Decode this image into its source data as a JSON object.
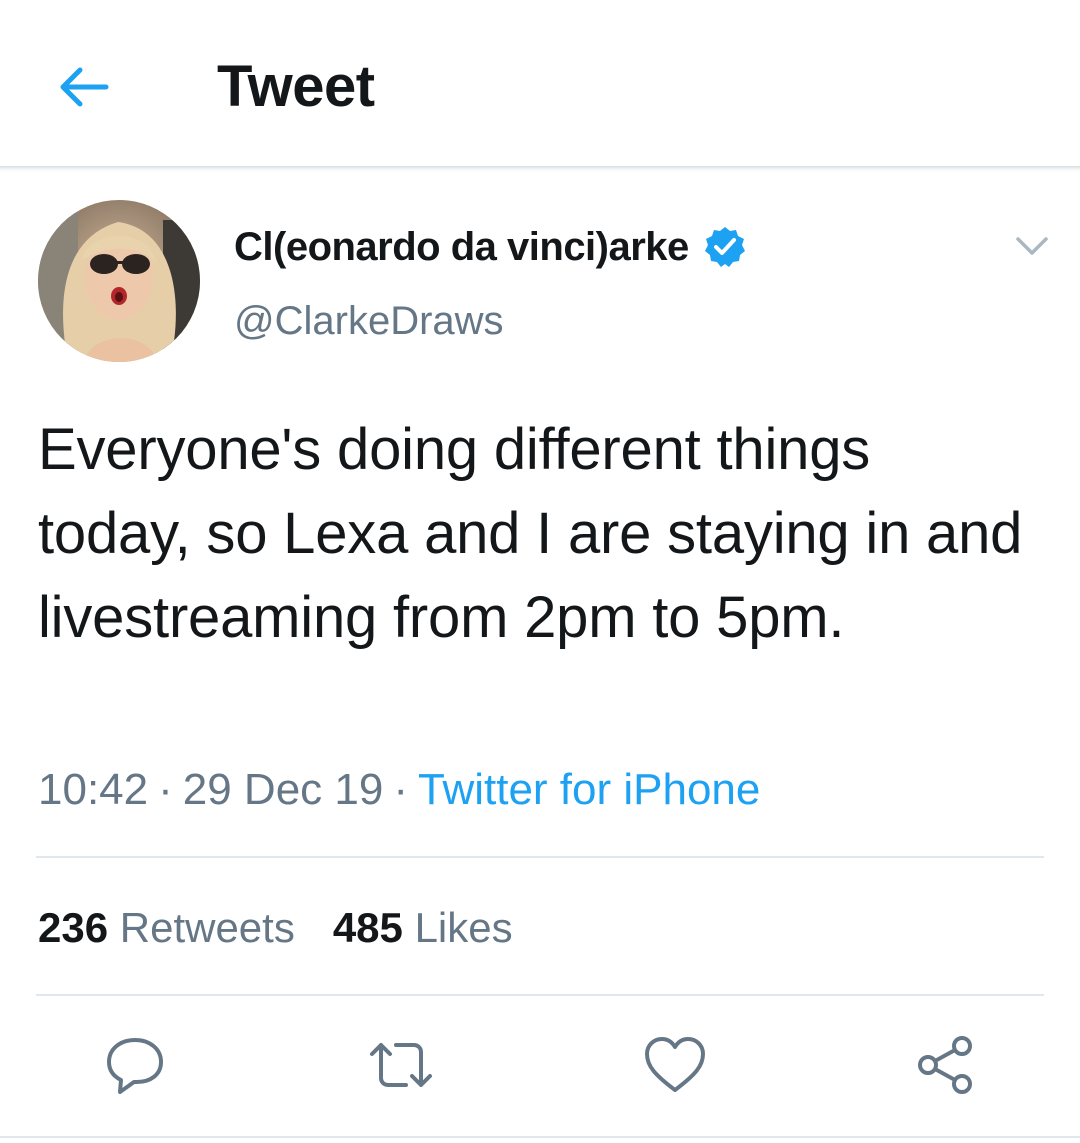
{
  "header": {
    "title": "Tweet",
    "back_icon": "arrow-left-icon"
  },
  "tweet": {
    "display_name": "Cl(eonardo da vinci)arke",
    "handle": "@ClarkeDraws",
    "verified": true,
    "text": "Everyone's doing different things today, so Lexa and I are staying in and livestreaming from 2pm to 5pm.",
    "time": "10:42",
    "date": "29 Dec 19",
    "source": "Twitter for iPhone",
    "separator": "·"
  },
  "stats": {
    "retweets_count": "236",
    "retweets_label": "Retweets",
    "likes_count": "485",
    "likes_label": "Likes"
  },
  "actions": [
    {
      "icon": "reply-icon"
    },
    {
      "icon": "retweet-icon"
    },
    {
      "icon": "like-heart-icon"
    },
    {
      "icon": "share-icon"
    }
  ],
  "colors": {
    "accent": "#1da1f2",
    "text": "#14171a",
    "secondary": "#657786",
    "divider": "#e1e8ed"
  }
}
